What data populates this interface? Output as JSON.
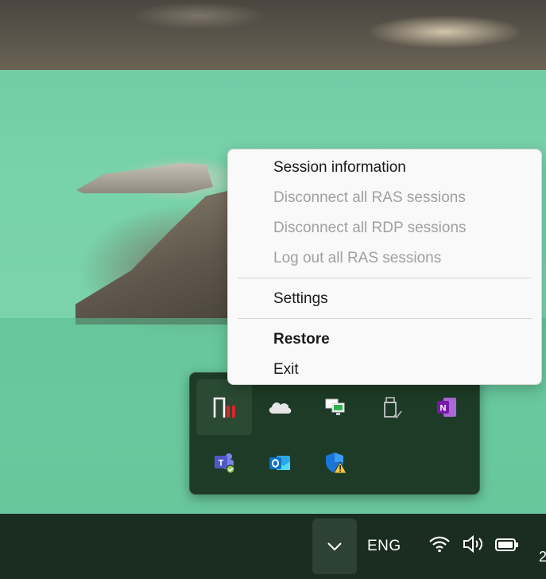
{
  "menu": {
    "items": [
      {
        "label": "Session information",
        "enabled": true,
        "bold": false
      },
      {
        "label": "Disconnect all RAS sessions",
        "enabled": false,
        "bold": false
      },
      {
        "label": "Disconnect all RDP sessions",
        "enabled": false,
        "bold": false
      },
      {
        "label": "Log out all RAS sessions",
        "enabled": false,
        "bold": false
      },
      {
        "label": "Settings",
        "enabled": true,
        "bold": false
      },
      {
        "label": "Restore",
        "enabled": true,
        "bold": true
      },
      {
        "label": "Exit",
        "enabled": true,
        "bold": false
      }
    ]
  },
  "tray": {
    "icons": [
      "parallels-client-icon",
      "onedrive-icon",
      "network-monitor-icon",
      "usb-drive-icon",
      "onenote-icon",
      "teams-icon",
      "outlook-icon",
      "defender-warning-icon"
    ]
  },
  "taskbar": {
    "language": "ENG",
    "clock_fragment": "2",
    "icons": [
      "chevron-up-icon",
      "wifi-icon",
      "volume-icon",
      "battery-icon"
    ]
  },
  "colors": {
    "menu_bg": "#f9f9f9",
    "disabled_text": "#a0a0a0",
    "taskbar_bg": "#1b2c20",
    "tray_bg": "#1d3b26",
    "parallels_red": "#d9262b",
    "onenote_purple": "#7719aa",
    "outlook_blue": "#0a72c6",
    "teams_purple": "#5059c9"
  }
}
